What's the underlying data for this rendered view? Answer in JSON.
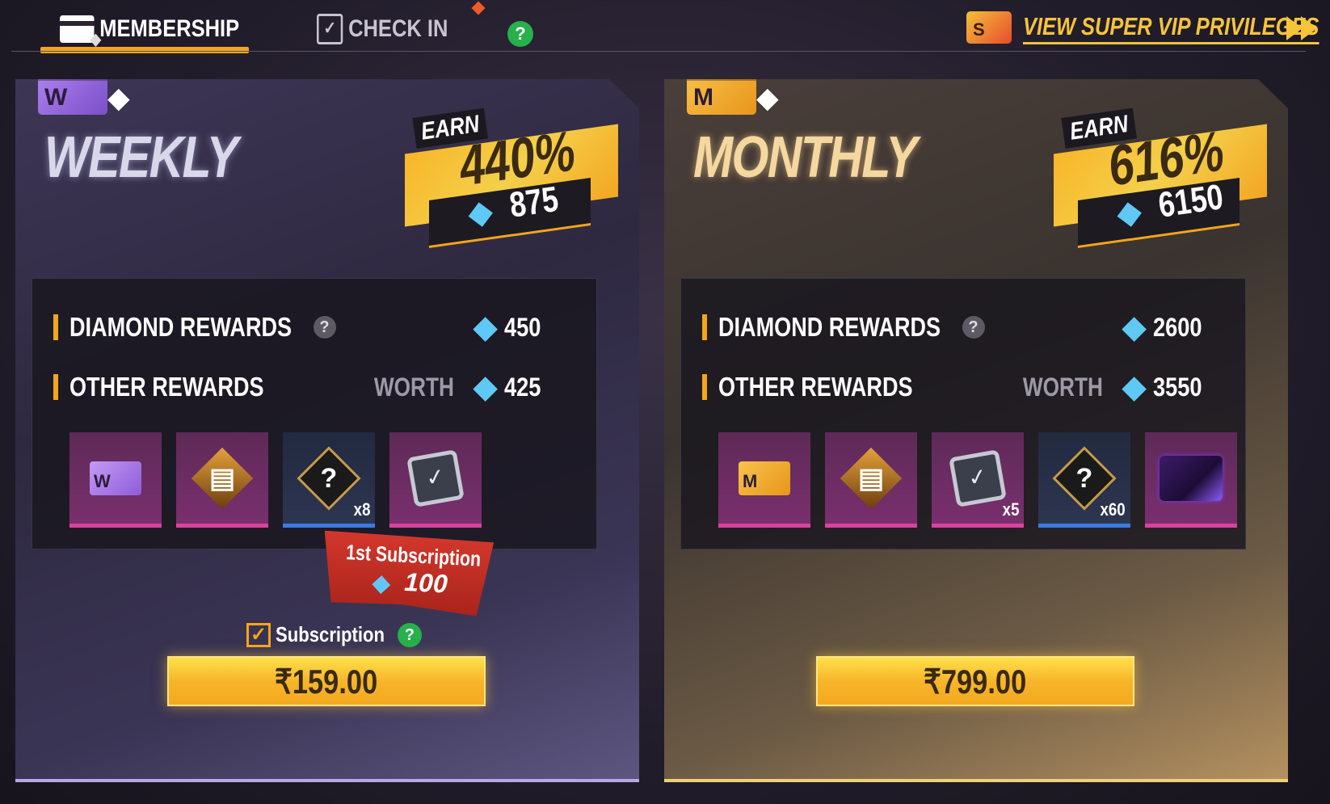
{
  "tabs": {
    "membership": "MEMBERSHIP",
    "check_in": "CHECK IN",
    "help": "?"
  },
  "vip_link": {
    "label": "VIEW SUPER VIP PRIVILEGES",
    "badge": "S"
  },
  "weekly": {
    "badge": "W",
    "title": "WEEKLY",
    "earn_label": "EARN",
    "earn_percent": "440%",
    "earn_diamonds": "875",
    "diamond_rewards_label": "DIAMOND REWARDS",
    "diamond_rewards_value": "450",
    "other_rewards_label": "OTHER REWARDS",
    "worth_label": "WORTH",
    "other_rewards_value": "425",
    "items": [
      {
        "icon": "weekly-card-icon",
        "qty": ""
      },
      {
        "icon": "voucher-cards-icon",
        "qty": ""
      },
      {
        "icon": "mystery-box-icon",
        "qty": "x8"
      },
      {
        "icon": "check-in-calendar-icon",
        "qty": ""
      }
    ],
    "first_subscription": {
      "label": "1st Subscription",
      "value": "100"
    },
    "subscription_label": "Subscription",
    "price": "₹159.00"
  },
  "monthly": {
    "badge": "M",
    "title": "MONTHLY",
    "earn_label": "EARN",
    "earn_percent": "616%",
    "earn_diamonds": "6150",
    "diamond_rewards_label": "DIAMOND REWARDS",
    "diamond_rewards_value": "2600",
    "other_rewards_label": "OTHER REWARDS",
    "worth_label": "WORTH",
    "other_rewards_value": "3550",
    "items": [
      {
        "icon": "monthly-card-icon",
        "qty": ""
      },
      {
        "icon": "voucher-cards-icon",
        "qty": ""
      },
      {
        "icon": "check-in-calendar-icon",
        "qty": "x5"
      },
      {
        "icon": "mystery-box-icon",
        "qty": "x60"
      },
      {
        "icon": "loot-chest-icon",
        "qty": ""
      }
    ],
    "price": "₹799.00"
  },
  "colors": {
    "accent": "#f4a51c",
    "weekly_accent": "#b7a7e6",
    "monthly_accent": "#f0cf7a",
    "diamond": "#5fc8f5",
    "help_green": "#27b04b"
  }
}
